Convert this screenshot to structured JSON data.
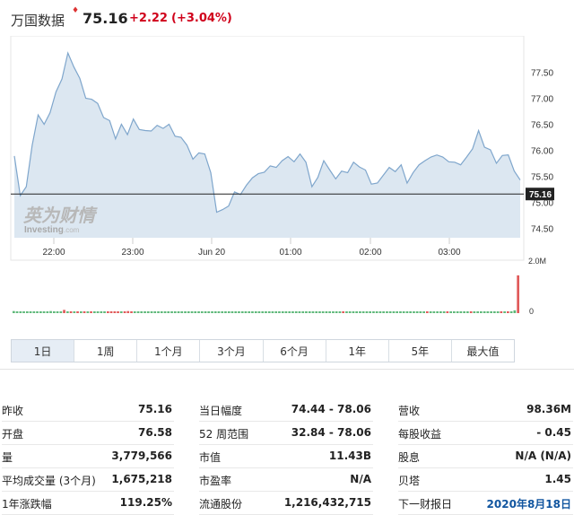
{
  "header": {
    "name": "万国数据",
    "price": "75.16",
    "change": "+2.22",
    "change_pct": "(+3.04%)",
    "change_color": "#d0021b"
  },
  "chart_data": {
    "type": "area",
    "x_labels": [
      "22:00",
      "23:00",
      "Jun 20",
      "01:00",
      "02:00",
      "03:00"
    ],
    "y_ticks": [
      "77.50",
      "77.00",
      "76.50",
      "76.00",
      "75.50",
      "75.00",
      "74.50"
    ],
    "ylim": [
      74.44,
      78.06
    ],
    "current_price_label": "75.16",
    "current_price": 75.16,
    "watermark": {
      "cn": "英为财情",
      "en": "Investing",
      "suffix": ".com"
    },
    "series": [
      {
        "values": [
          75.89,
          75.13,
          75.3,
          76.1,
          76.68,
          76.5,
          76.72,
          77.12,
          77.37,
          77.87,
          77.6,
          77.38,
          77.0,
          76.98,
          76.9,
          76.63,
          76.57,
          76.22,
          76.5,
          76.3,
          76.6,
          76.4,
          76.38,
          76.37,
          76.48,
          76.42,
          76.5,
          76.27,
          76.25,
          76.1,
          75.83,
          75.95,
          75.93,
          75.57,
          74.81,
          74.86,
          74.93,
          75.2,
          75.15,
          75.33,
          75.47,
          75.55,
          75.58,
          75.7,
          75.67,
          75.8,
          75.88,
          75.78,
          75.93,
          75.77,
          75.3,
          75.48,
          75.8,
          75.62,
          75.45,
          75.6,
          75.57,
          75.77,
          75.68,
          75.62,
          75.35,
          75.37,
          75.52,
          75.67,
          75.59,
          75.72,
          75.37,
          75.57,
          75.72,
          75.8,
          75.87,
          75.91,
          75.87,
          75.78,
          75.77,
          75.72,
          75.87,
          76.03,
          76.38,
          76.06,
          76.01,
          75.75,
          75.9,
          75.91,
          75.6,
          75.43
        ]
      }
    ],
    "volume": {
      "axis_labels": [
        "2.0M",
        "0"
      ],
      "max": 2000000,
      "bars": [
        {
          "v": 90000,
          "c": "#5fb87a"
        },
        {
          "v": 60000,
          "c": "#5fb87a"
        },
        {
          "v": 60000,
          "c": "#5fb87a"
        },
        {
          "v": 60000,
          "c": "#5fb87a"
        },
        {
          "v": 60000,
          "c": "#5fb87a"
        },
        {
          "v": 60000,
          "c": "#5fb87a"
        },
        {
          "v": 60000,
          "c": "#5fb87a"
        },
        {
          "v": 60000,
          "c": "#5fb87a"
        },
        {
          "v": 0,
          "c": "#5fb87a"
        },
        {
          "v": 60000,
          "c": "#5fb87a"
        },
        {
          "v": 60000,
          "c": "#5fb87a"
        },
        {
          "v": 90000,
          "c": "#5fb87a"
        },
        {
          "v": 60000,
          "c": "#5fb87a"
        },
        {
          "v": 60000,
          "c": "#5fb87a"
        },
        {
          "v": 60000,
          "c": "#5fb87a"
        },
        {
          "v": 140000,
          "c": "#e05a5a"
        },
        {
          "v": 0,
          "c": "#5fb87a"
        },
        {
          "v": 60000,
          "c": "#e05a5a"
        },
        {
          "v": 0,
          "c": "#5fb87a"
        },
        {
          "v": 60000,
          "c": "#e05a5a"
        },
        {
          "v": 0,
          "c": "#5fb87a"
        },
        {
          "v": 60000,
          "c": "#e05a5a"
        },
        {
          "v": 0,
          "c": "#5fb87a"
        },
        {
          "v": 60000,
          "c": "#e05a5a"
        },
        {
          "v": 0,
          "c": "#5fb87a"
        },
        {
          "v": 0,
          "c": "#5fb87a"
        },
        {
          "v": 0,
          "c": "#5fb87a"
        },
        {
          "v": 0,
          "c": "#5fb87a"
        },
        {
          "v": 60000,
          "c": "#e05a5a"
        },
        {
          "v": 60000,
          "c": "#e05a5a"
        },
        {
          "v": 60000,
          "c": "#e05a5a"
        },
        {
          "v": 60000,
          "c": "#e05a5a"
        },
        {
          "v": 0,
          "c": "#5fb87a"
        },
        {
          "v": 60000,
          "c": "#e05a5a"
        },
        {
          "v": 90000,
          "c": "#e05a5a"
        },
        {
          "v": 60000,
          "c": "#e05a5a"
        },
        {
          "v": 0,
          "c": "#5fb87a"
        },
        {
          "v": 0,
          "c": "#5fb87a"
        },
        {
          "v": 0,
          "c": "#5fb87a"
        },
        {
          "v": 0,
          "c": "#5fb87a"
        },
        {
          "v": 0,
          "c": "#5fb87a"
        },
        {
          "v": 0,
          "c": "#5fb87a"
        },
        {
          "v": 60000,
          "c": "#5fb87a"
        },
        {
          "v": 60000,
          "c": "#5fb87a"
        },
        {
          "v": 0,
          "c": "#5fb87a"
        },
        {
          "v": 0,
          "c": "#5fb87a"
        },
        {
          "v": 0,
          "c": "#5fb87a"
        },
        {
          "v": 0,
          "c": "#5fb87a"
        },
        {
          "v": 0,
          "c": "#5fb87a"
        },
        {
          "v": 0,
          "c": "#5fb87a"
        },
        {
          "v": 0,
          "c": "#5fb87a"
        },
        {
          "v": 0,
          "c": "#5fb87a"
        },
        {
          "v": 0,
          "c": "#5fb87a"
        },
        {
          "v": 0,
          "c": "#5fb87a"
        },
        {
          "v": 0,
          "c": "#5fb87a"
        },
        {
          "v": 0,
          "c": "#5fb87a"
        },
        {
          "v": 0,
          "c": "#5fb87a"
        },
        {
          "v": 0,
          "c": "#5fb87a"
        },
        {
          "v": 0,
          "c": "#5fb87a"
        },
        {
          "v": 0,
          "c": "#5fb87a"
        },
        {
          "v": 0,
          "c": "#5fb87a"
        },
        {
          "v": 0,
          "c": "#5fb87a"
        },
        {
          "v": 0,
          "c": "#5fb87a"
        },
        {
          "v": 0,
          "c": "#5fb87a"
        },
        {
          "v": 0,
          "c": "#5fb87a"
        },
        {
          "v": 0,
          "c": "#5fb87a"
        },
        {
          "v": 0,
          "c": "#5fb87a"
        },
        {
          "v": 0,
          "c": "#5fb87a"
        },
        {
          "v": 0,
          "c": "#5fb87a"
        },
        {
          "v": 0,
          "c": "#5fb87a"
        },
        {
          "v": 0,
          "c": "#5fb87a"
        },
        {
          "v": 0,
          "c": "#5fb87a"
        },
        {
          "v": 0,
          "c": "#5fb87a"
        },
        {
          "v": 0,
          "c": "#5fb87a"
        },
        {
          "v": 0,
          "c": "#5fb87a"
        },
        {
          "v": 0,
          "c": "#5fb87a"
        },
        {
          "v": 0,
          "c": "#5fb87a"
        },
        {
          "v": 0,
          "c": "#5fb87a"
        },
        {
          "v": 0,
          "c": "#5fb87a"
        },
        {
          "v": 0,
          "c": "#5fb87a"
        },
        {
          "v": 0,
          "c": "#5fb87a"
        },
        {
          "v": 0,
          "c": "#5fb87a"
        },
        {
          "v": 0,
          "c": "#5fb87a"
        },
        {
          "v": 0,
          "c": "#5fb87a"
        },
        {
          "v": 0,
          "c": "#5fb87a"
        },
        {
          "v": 0,
          "c": "#5fb87a"
        },
        {
          "v": 0,
          "c": "#5fb87a"
        },
        {
          "v": 0,
          "c": "#5fb87a"
        },
        {
          "v": 0,
          "c": "#5fb87a"
        },
        {
          "v": 0,
          "c": "#5fb87a"
        },
        {
          "v": 0,
          "c": "#5fb87a"
        },
        {
          "v": 0,
          "c": "#5fb87a"
        },
        {
          "v": 0,
          "c": "#5fb87a"
        },
        {
          "v": 0,
          "c": "#5fb87a"
        },
        {
          "v": 0,
          "c": "#5fb87a"
        },
        {
          "v": 0,
          "c": "#5fb87a"
        },
        {
          "v": 0,
          "c": "#5fb87a"
        },
        {
          "v": 0,
          "c": "#5fb87a"
        },
        {
          "v": 60000,
          "c": "#e05a5a"
        },
        {
          "v": 0,
          "c": "#5fb87a"
        },
        {
          "v": 0,
          "c": "#5fb87a"
        },
        {
          "v": 0,
          "c": "#5fb87a"
        },
        {
          "v": 0,
          "c": "#5fb87a"
        },
        {
          "v": 0,
          "c": "#5fb87a"
        },
        {
          "v": 0,
          "c": "#5fb87a"
        },
        {
          "v": 0,
          "c": "#5fb87a"
        },
        {
          "v": 0,
          "c": "#5fb87a"
        },
        {
          "v": 0,
          "c": "#5fb87a"
        },
        {
          "v": 0,
          "c": "#5fb87a"
        },
        {
          "v": 0,
          "c": "#5fb87a"
        },
        {
          "v": 0,
          "c": "#5fb87a"
        },
        {
          "v": 0,
          "c": "#5fb87a"
        },
        {
          "v": 0,
          "c": "#5fb87a"
        },
        {
          "v": 0,
          "c": "#5fb87a"
        },
        {
          "v": 0,
          "c": "#5fb87a"
        },
        {
          "v": 0,
          "c": "#5fb87a"
        },
        {
          "v": 0,
          "c": "#5fb87a"
        },
        {
          "v": 60000,
          "c": "#5fb87a"
        },
        {
          "v": 0,
          "c": "#5fb87a"
        },
        {
          "v": 0,
          "c": "#5fb87a"
        },
        {
          "v": 0,
          "c": "#5fb87a"
        },
        {
          "v": 0,
          "c": "#5fb87a"
        },
        {
          "v": 0,
          "c": "#5fb87a"
        },
        {
          "v": 60000,
          "c": "#e05a5a"
        },
        {
          "v": 0,
          "c": "#5fb87a"
        },
        {
          "v": 60000,
          "c": "#5fb87a"
        },
        {
          "v": 0,
          "c": "#5fb87a"
        },
        {
          "v": 0,
          "c": "#5fb87a"
        },
        {
          "v": 0,
          "c": "#5fb87a"
        },
        {
          "v": 60000,
          "c": "#e05a5a"
        },
        {
          "v": 0,
          "c": "#5fb87a"
        },
        {
          "v": 0,
          "c": "#5fb87a"
        },
        {
          "v": 0,
          "c": "#5fb87a"
        },
        {
          "v": 60000,
          "c": "#5fb87a"
        },
        {
          "v": 0,
          "c": "#5fb87a"
        },
        {
          "v": 0,
          "c": "#5fb87a"
        },
        {
          "v": 60000,
          "c": "#e05a5a"
        },
        {
          "v": 0,
          "c": "#5fb87a"
        },
        {
          "v": 60000,
          "c": "#5fb87a"
        },
        {
          "v": 60000,
          "c": "#5fb87a"
        },
        {
          "v": 60000,
          "c": "#5fb87a"
        },
        {
          "v": 60000,
          "c": "#5fb87a"
        },
        {
          "v": 60000,
          "c": "#5fb87a"
        },
        {
          "v": 60000,
          "c": "#5fb87a"
        },
        {
          "v": 60000,
          "c": "#5fb87a"
        },
        {
          "v": 60000,
          "c": "#e05a5a"
        },
        {
          "v": 60000,
          "c": "#5fb87a"
        },
        {
          "v": 60000,
          "c": "#e05a5a"
        },
        {
          "v": 60000,
          "c": "#5fb87a"
        },
        {
          "v": 120000,
          "c": "#5fb87a"
        },
        {
          "v": 1650000,
          "c": "#e05a5a"
        }
      ]
    }
  },
  "tabs": [
    {
      "label": "1日",
      "active": true
    },
    {
      "label": "1周",
      "active": false
    },
    {
      "label": "1个月",
      "active": false
    },
    {
      "label": "3个月",
      "active": false
    },
    {
      "label": "6个月",
      "active": false
    },
    {
      "label": "1年",
      "active": false
    },
    {
      "label": "5年",
      "active": false
    },
    {
      "label": "最大值",
      "active": false
    }
  ],
  "stats": {
    "col1": [
      {
        "label": "昨收",
        "value": "75.16"
      },
      {
        "label": "开盘",
        "value": "76.58"
      },
      {
        "label": "量",
        "value": "3,779,566"
      },
      {
        "label": "平均成交量 (3个月)",
        "value": "1,675,218"
      },
      {
        "label": "1年涨跌幅",
        "value": "119.25%"
      }
    ],
    "col2": [
      {
        "label": "当日幅度",
        "value": "74.44 - 78.06"
      },
      {
        "label": "52 周范围",
        "value": "32.84 - 78.06"
      },
      {
        "label": "市值",
        "value": "11.43B"
      },
      {
        "label": "市盈率",
        "value": "N/A"
      },
      {
        "label": "流通股份",
        "value": "1,216,432,715"
      }
    ],
    "col3": [
      {
        "label": "营收",
        "value": "98.36M"
      },
      {
        "label": "每股收益",
        "value": "- 0.45"
      },
      {
        "label": "股息",
        "value": "N/A (N/A)"
      },
      {
        "label": "贝塔",
        "value": "1.45"
      },
      {
        "label": "下一财报日",
        "value": "2020年8月18日",
        "link": true
      }
    ]
  }
}
